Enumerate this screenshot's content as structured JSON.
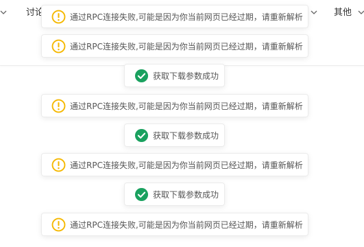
{
  "colors": {
    "warning": "#f5b800",
    "success": "#1aa15f",
    "toast_bg": "#ffffff",
    "text": "#555555"
  },
  "nav": {
    "item_discuss": "讨论",
    "item_other": "其他"
  },
  "toasts": [
    {
      "type": "warning",
      "icon": "warning-circle-icon",
      "text": "通过RPC连接失败,可能是因为你当前网页已经过期，请重新解析"
    },
    {
      "type": "warning",
      "icon": "warning-circle-icon",
      "text": "通过RPC连接失败,可能是因为你当前网页已经过期，请重新解析"
    },
    {
      "type": "success",
      "icon": "check-circle-icon",
      "text": "获取下载参数成功"
    },
    {
      "type": "warning",
      "icon": "warning-circle-icon",
      "text": "通过RPC连接失败,可能是因为你当前网页已经过期，请重新解析"
    },
    {
      "type": "success",
      "icon": "check-circle-icon",
      "text": "获取下载参数成功"
    },
    {
      "type": "warning",
      "icon": "warning-circle-icon",
      "text": "通过RPC连接失败,可能是因为你当前网页已经过期，请重新解析"
    },
    {
      "type": "success",
      "icon": "check-circle-icon",
      "text": "获取下载参数成功"
    },
    {
      "type": "warning",
      "icon": "warning-circle-icon",
      "text": "通过RPC连接失败,可能是因为你当前网页已经过期，请重新解析"
    }
  ]
}
